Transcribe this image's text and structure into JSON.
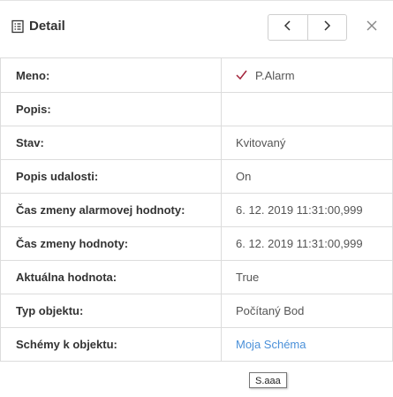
{
  "header": {
    "title": "Detail",
    "title_icon": "list-detail-icon",
    "prev_icon": "chevron-left-icon",
    "next_icon": "chevron-right-icon",
    "close_icon": "close-icon"
  },
  "rows": [
    {
      "label": "Meno:",
      "value": "P.Alarm",
      "icon": "check-icon",
      "icon_color": "#a3223a"
    },
    {
      "label": "Popis:",
      "value": ""
    },
    {
      "label": "Stav:",
      "value": "Kvitovaný"
    },
    {
      "label": "Popis udalosti:",
      "value": "On"
    },
    {
      "label": "Čas zmeny alarmovej hodnoty:",
      "value": "6. 12. 2019 11:31:00,999"
    },
    {
      "label": "Čas zmeny hodnoty:",
      "value": "6. 12. 2019 11:31:00,999"
    },
    {
      "label": "Aktuálna hodnota:",
      "value": "True"
    },
    {
      "label": "Typ objektu:",
      "value": "Počítaný Bod"
    },
    {
      "label": "Schémy k objektu:",
      "value": "Moja Schéma",
      "link_color": "#4a90d9"
    }
  ],
  "tooltip": {
    "text": "S.aaa"
  }
}
